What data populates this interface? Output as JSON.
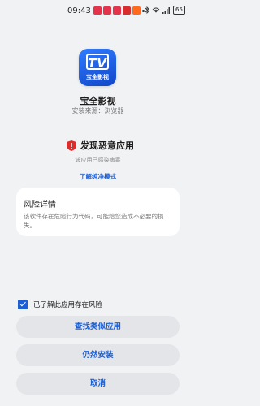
{
  "status_bar": {
    "time": "09:43",
    "battery": "65"
  },
  "app": {
    "name": "宝全影视",
    "source": "安装来源：浏览器",
    "icon_caption": "宝全影视",
    "icon_letters": "TV"
  },
  "warning": {
    "title": "发现恶意应用",
    "subtitle": "该应用已感染病毒",
    "link": "了解纯净模式"
  },
  "risk": {
    "title": "风险详情",
    "body": "该软件存在危险行为代码，可能给您造成不必要的损失。"
  },
  "consent": {
    "label": "已了解此应用存在风险",
    "checked": true
  },
  "buttons": {
    "find_similar": "查找类似应用",
    "install_anyway": "仍然安装",
    "cancel": "取消"
  },
  "colors": {
    "accent": "#1a5fd6",
    "danger": "#e02b2b",
    "background": "#f1f2f4"
  }
}
